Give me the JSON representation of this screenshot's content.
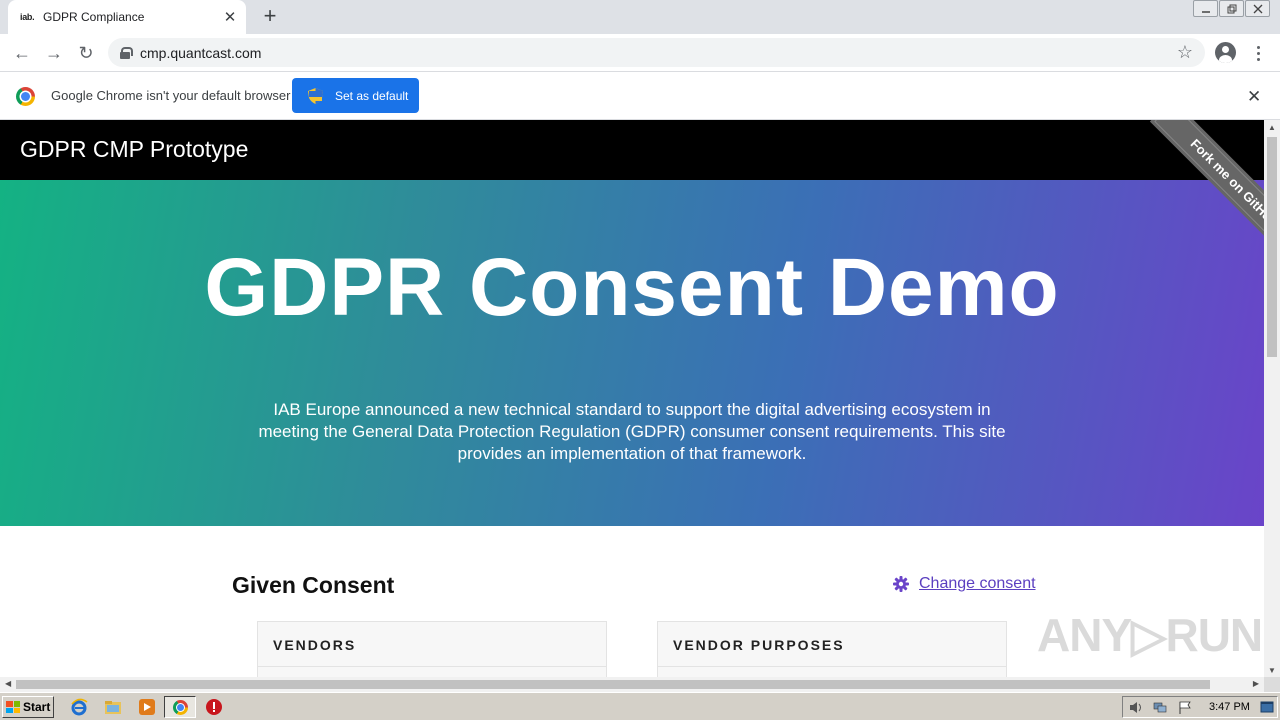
{
  "browser": {
    "tab_favicon": "iab.",
    "tab_title": "GDPR Compliance",
    "tab_close": "✕",
    "new_tab": "+",
    "url": "cmp.quantcast.com",
    "back": "←",
    "forward": "→",
    "reload": "↻",
    "star": "☆"
  },
  "infobar": {
    "message": "Google Chrome isn't your default browser",
    "button_label": "Set as default",
    "close": "✕"
  },
  "site": {
    "header_title": "GDPR CMP Prototype",
    "ribbon": "Fork me on GitHub",
    "hero_title": "GDPR Consent Demo",
    "hero_description": "IAB Europe announced a new technical standard to support the digital advertising ecosystem in meeting the General Data Protection Regulation (GDPR) consumer consent requirements. This site provides an implementation of that framework.",
    "section_title": "Given Consent",
    "change_consent": "Change consent",
    "cards": [
      {
        "title": "VENDORS"
      },
      {
        "title": "VENDOR PURPOSES"
      }
    ]
  },
  "watermark": "ANY▷RUN",
  "taskbar": {
    "start_label": "Start",
    "clock": "3:47 PM"
  },
  "colors": {
    "accent": "#1a73e8",
    "hero_gradient_start": "#14b283",
    "hero_gradient_end": "#6a44c9",
    "link": "#5b3fc0"
  }
}
